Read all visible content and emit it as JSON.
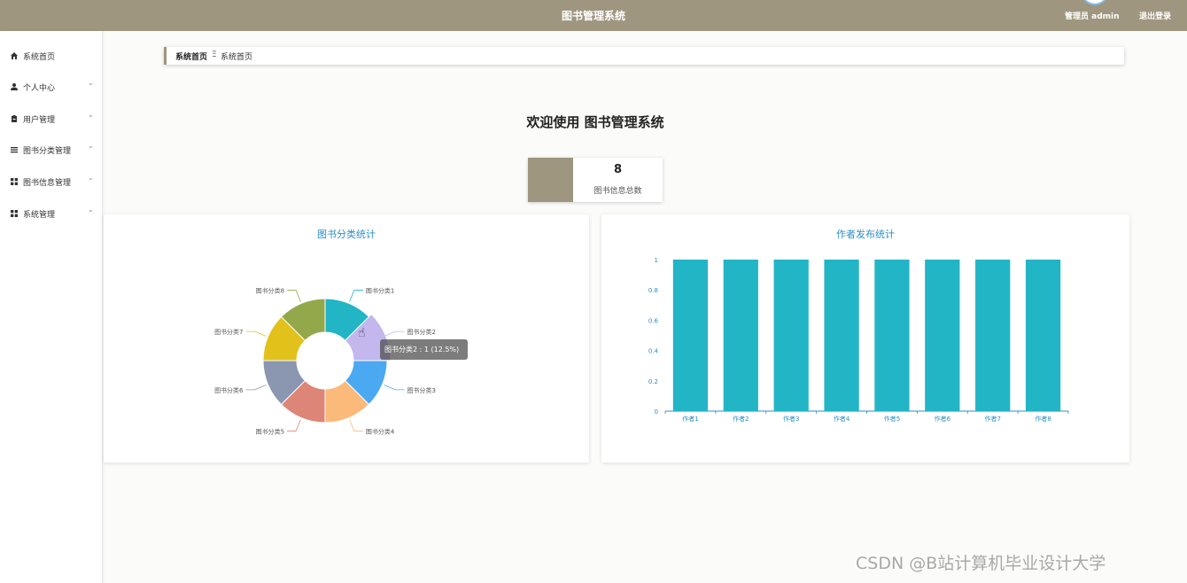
{
  "header": {
    "title": "图书管理系统",
    "user_label": "管理员 admin",
    "logout_label": "退出登录"
  },
  "sidebar": {
    "items": [
      {
        "label": "系统首页",
        "icon": "home-icon",
        "has_arrow": false
      },
      {
        "label": "个人中心",
        "icon": "user-icon",
        "has_arrow": true
      },
      {
        "label": "用户管理",
        "icon": "clipboard-icon",
        "has_arrow": true
      },
      {
        "label": "图书分类管理",
        "icon": "list-icon",
        "has_arrow": true
      },
      {
        "label": "图书信息管理",
        "icon": "grid-icon",
        "has_arrow": true
      },
      {
        "label": "系统管理",
        "icon": "grid-icon",
        "has_arrow": true
      }
    ]
  },
  "breadcrumb": {
    "home": "系统首页",
    "separator": "Ξ",
    "current": "系统首页"
  },
  "welcome": "欢迎使用 图书管理系统",
  "stat": {
    "value": "8",
    "label": "图书信息总数"
  },
  "pie_card": {
    "title": "图书分类统计"
  },
  "bar_card": {
    "title": "作者发布统计"
  },
  "tooltip": "图书分类2 : 1 (12.5%)",
  "watermark": "CSDN @B站计算机毕业设计大学",
  "colors": {
    "accent": "#9e967e",
    "bar": "#22b5c5",
    "title_blue": "#2a8fc5"
  },
  "chart_data": [
    {
      "type": "pie",
      "title": "图书分类统计",
      "categories": [
        "图书分类1",
        "图书分类2",
        "图书分类3",
        "图书分类4",
        "图书分类5",
        "图书分类6",
        "图书分类7",
        "图书分类8"
      ],
      "values": [
        1,
        1,
        1,
        1,
        1,
        1,
        1,
        1
      ],
      "colors": [
        "#22b5c5",
        "#c3b7ee",
        "#4aa9f0",
        "#fbb97a",
        "#dd8576",
        "#8b97b1",
        "#e2c21a",
        "#93a84b"
      ],
      "donut": true
    },
    {
      "type": "bar",
      "title": "作者发布统计",
      "categories": [
        "作者1",
        "作者2",
        "作者3",
        "作者4",
        "作者5",
        "作者6",
        "作者7",
        "作者8"
      ],
      "values": [
        1,
        1,
        1,
        1,
        1,
        1,
        1,
        1
      ],
      "ylim": [
        0,
        1
      ],
      "yticks": [
        "0",
        "0.2",
        "0.4",
        "0.6",
        "0.8",
        "1"
      ],
      "grid": false
    }
  ]
}
